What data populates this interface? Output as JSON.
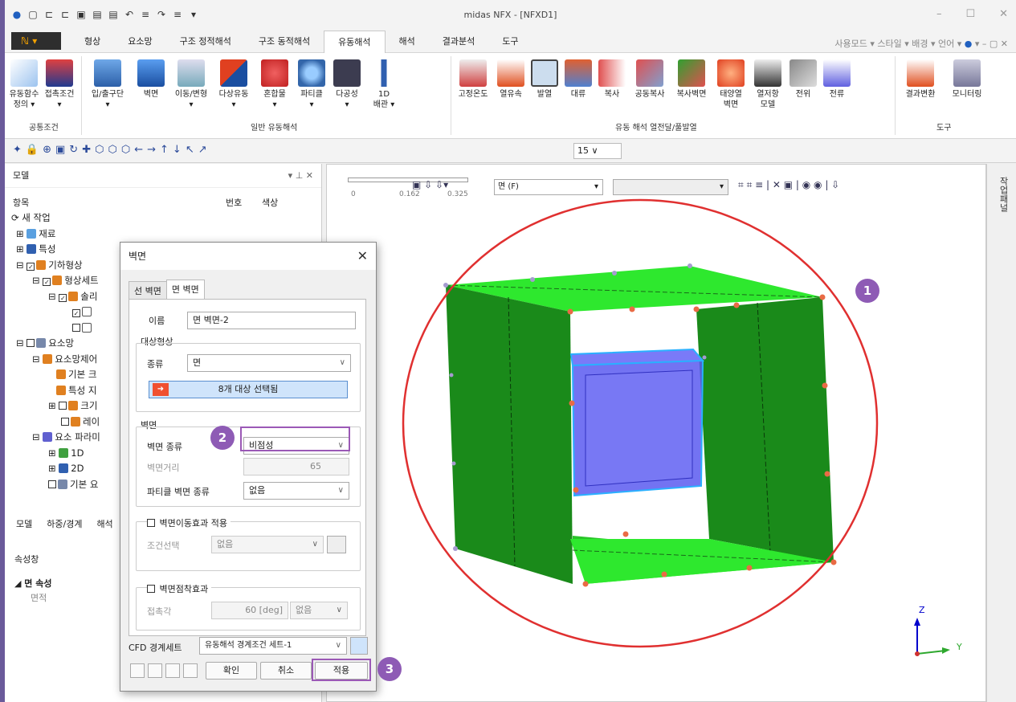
{
  "window": {
    "title": "midas NFX - [NFXD1]"
  },
  "menu": {
    "file": "",
    "tabs": [
      "형상",
      "요소망",
      "구조 정적해석",
      "구조 동적해석",
      "유동해석",
      "해석",
      "결과분석",
      "도구"
    ],
    "active_tab": "유동해석",
    "right": "사용모드 ▾ 스타일 ▾ 배경 ▾ 언어 ▾"
  },
  "ribbon": {
    "groups": {
      "boundary": "공통조건",
      "general": "일반 유동해석",
      "heat": "유동 해석 열전달/풀발열",
      "tools": "도구"
    },
    "buttons": {
      "flow_func": "유동함수\n정의 ▾",
      "contact": "접촉조건\n▾",
      "inlet": "입/출구단\n▾",
      "wall": "벽면",
      "move": "이동/변형\n▾",
      "multi": "다상유동\n▾",
      "mixture": "혼합물\n▾",
      "particle": "파티클\n▾",
      "porous": "다공성\n▾",
      "pipe": "1D\n배관 ▾",
      "fixed_temp": "고정온도",
      "heat_flux": "열유속",
      "heat_gen": "발열",
      "convection": "대류",
      "radiation": "복사",
      "cavity_rad": "공동복사",
      "rad_wall": "복사벽면",
      "solar": "태양열\n벽면",
      "thermal_res": "열저항\n모델",
      "potential": "전위",
      "current": "전류",
      "result_conv": "결과변환",
      "monitor": "모니터링"
    }
  },
  "toolbar": {
    "zoom": "15"
  },
  "left_panel": {
    "title": "모델",
    "columns": {
      "item": "항목",
      "number": "번호",
      "color": "색상"
    },
    "tree": [
      "새 작업",
      "재료",
      "특성",
      "기하형상",
      "형상세트",
      "솔리",
      "",
      "",
      "요소망",
      "요소망제어",
      "기본 크",
      "특성 지",
      "크기",
      "레이",
      "요소 파라미",
      "1D",
      "2D",
      "기본 요"
    ],
    "bottom_tabs": [
      "모델",
      "하중/경계",
      "해석"
    ],
    "props_title": "속성창",
    "props_group": "면 속성",
    "props_field": "면적"
  },
  "viewport": {
    "scale_labels": [
      "0",
      "0.162",
      "0.325"
    ],
    "face_combo": "면 (F)",
    "axis_z": "Z",
    "axis_y": "Y"
  },
  "right_sidebar": {
    "label": "작업패널"
  },
  "dialog": {
    "title": "벽면",
    "tabs": [
      "선 벽면",
      "면 벽면"
    ],
    "active_tab": "면 벽면",
    "name_label": "이름",
    "name_value": "면 벽면-2",
    "target_group": "대상형상",
    "type_label": "종류",
    "type_value": "면",
    "select_btn": "8개 대상 선택됨",
    "wall_group": "벽면",
    "wall_type_label": "벽면 종류",
    "wall_type_value": "비점성",
    "wall_dist_label": "벽면거리",
    "wall_dist_value": "65",
    "particle_wall_label": "파티클 벽면 종류",
    "particle_wall_value": "없음",
    "moving_wall_label": "벽면이동효과 적용",
    "cond_label": "조건선택",
    "cond_value": "없음",
    "adhesion_label": "벽면점착효과",
    "contact_angle_label": "접촉각",
    "contact_angle_value": "60 [deg]",
    "contact_angle_cond": "없음",
    "cfd_label": "CFD 경계세트",
    "cfd_value": "유동해석 경계조건 세트-1",
    "ok": "확인",
    "cancel": "취소",
    "apply": "적용"
  },
  "badges": [
    "1",
    "2",
    "3"
  ],
  "colors": {
    "accent": "#9b59b6",
    "green": "#1a8a1a",
    "lightgreen": "#2ee82e",
    "blue": "#5a5af0",
    "circle": "#e03030"
  }
}
